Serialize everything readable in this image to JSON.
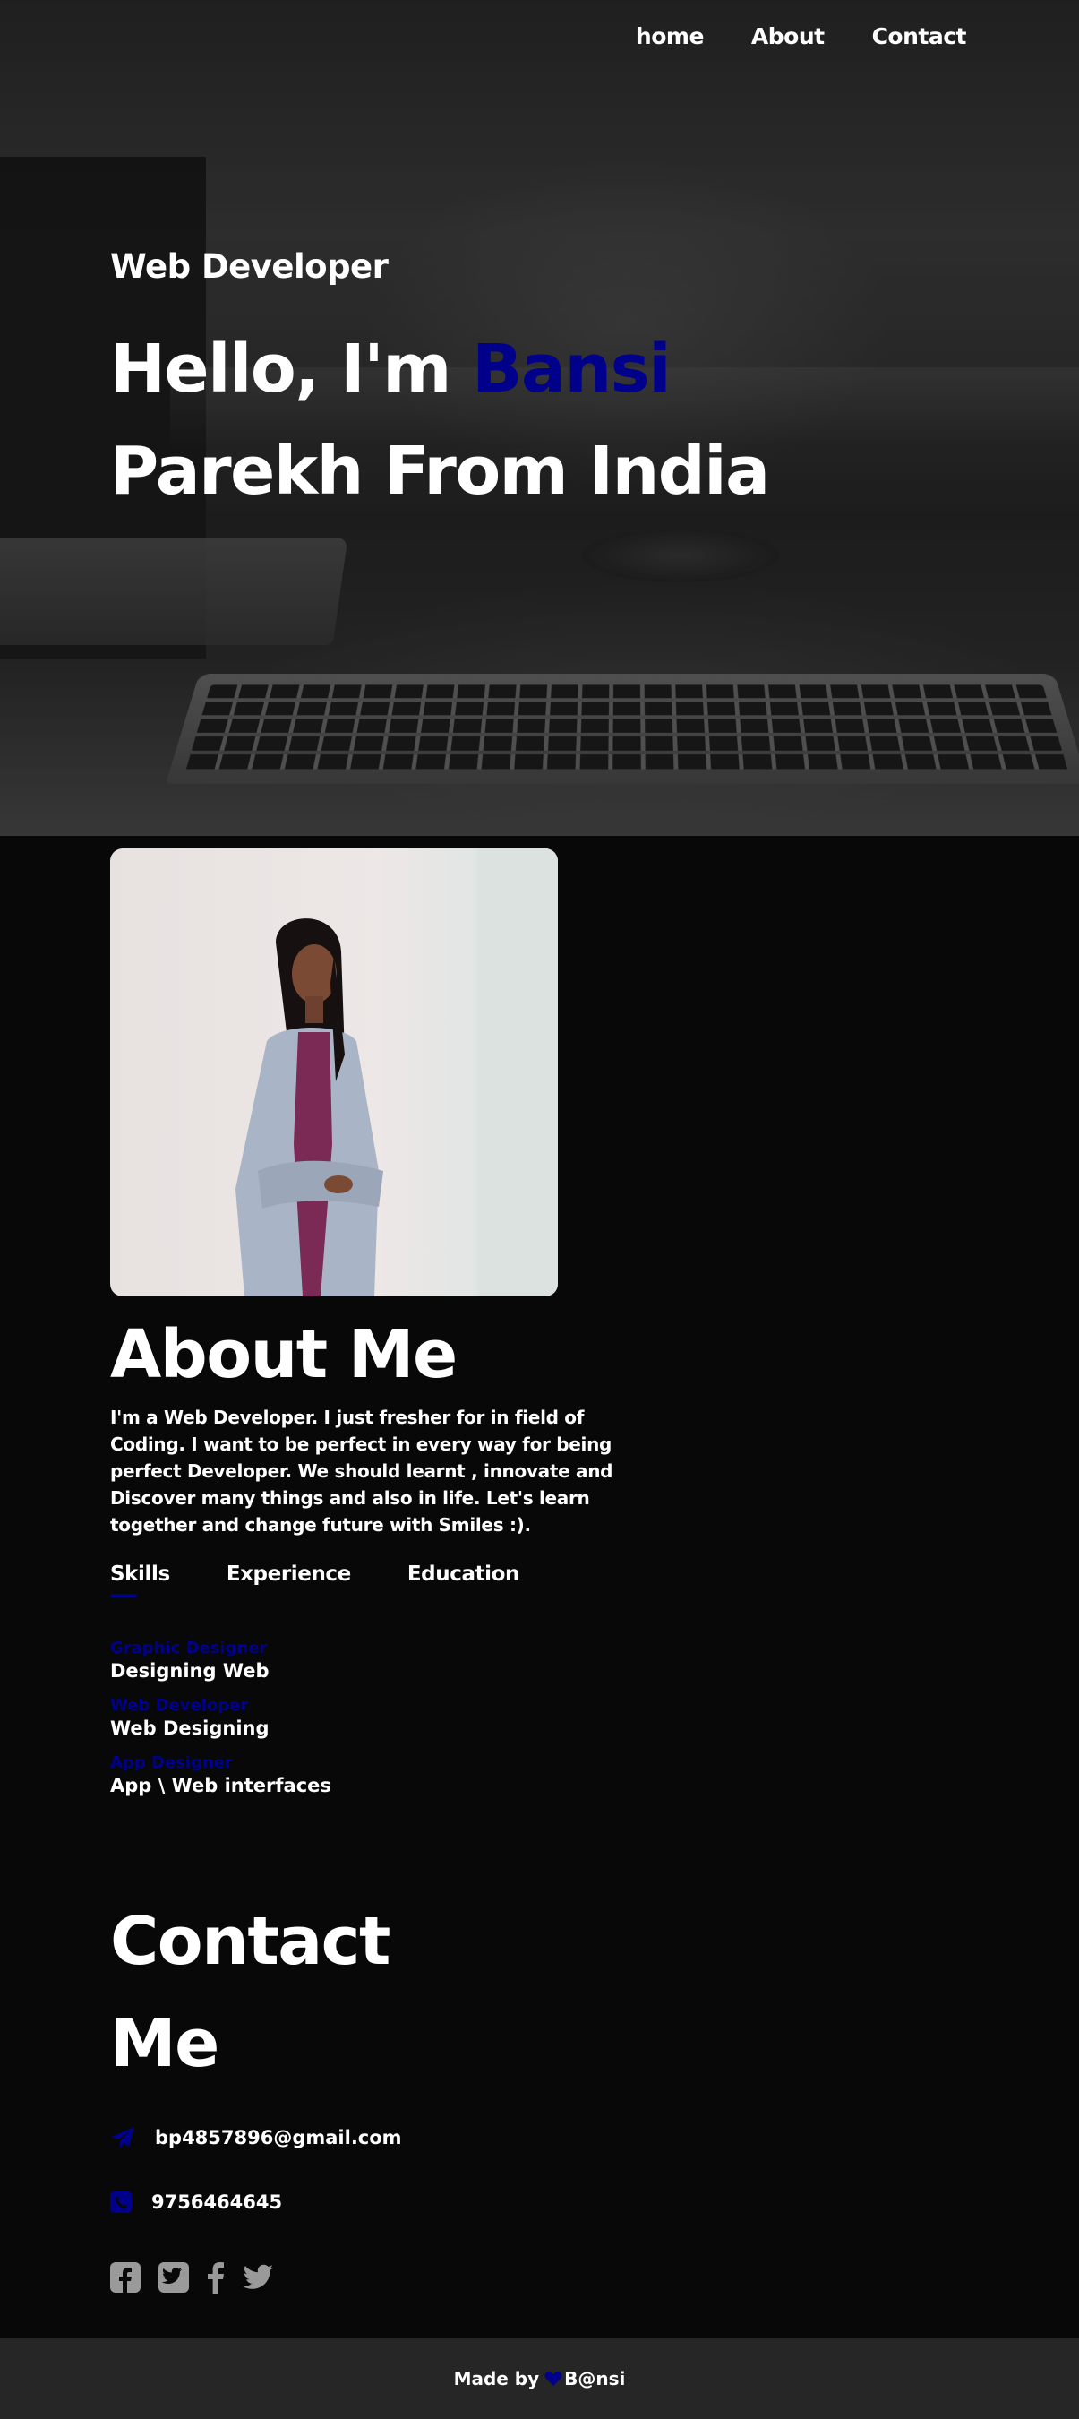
{
  "nav": {
    "items": [
      {
        "label": "home"
      },
      {
        "label": "About"
      },
      {
        "label": "Contact"
      }
    ]
  },
  "hero": {
    "subtitle": "Web Developer",
    "greeting": "Hello, I'm ",
    "name_highlight": "Bansi",
    "name_rest": "Parekh From India"
  },
  "about": {
    "title": "About Me",
    "text": "I'm a Web Developer. I just fresher for in field of Coding. I want to be perfect in every way for being perfect Developer. We should learnt , innovate and Discover many things and also in life. Let's learn together and change future with Smiles :).",
    "tabs": [
      {
        "label": "Skills",
        "active": true
      },
      {
        "label": "Experience",
        "active": false
      },
      {
        "label": "Education",
        "active": false
      }
    ],
    "skills": [
      {
        "role": "Graphic Designer",
        "desc": "Designing Web"
      },
      {
        "role": "Web Developer",
        "desc": "Web Designing"
      },
      {
        "role": "App Designer",
        "desc": "App \\ Web interfaces"
      }
    ]
  },
  "contact": {
    "title": "Contact Me",
    "email": "bp4857896@gmail.com",
    "phone": "9756464645",
    "email_icon": "paper-plane-icon",
    "phone_icon": "phone-square-icon",
    "socials": [
      "facebook-square-icon",
      "twitter-square-icon",
      "facebook-icon",
      "twitter-icon"
    ]
  },
  "footer": {
    "made_by": "Made by",
    "author": "B@nsi",
    "heart_icon": "heart-icon"
  },
  "colors": {
    "accent": "#00008b",
    "background": "#080808",
    "footer_bg": "#262626",
    "social_icon": "#9a9a9a"
  }
}
